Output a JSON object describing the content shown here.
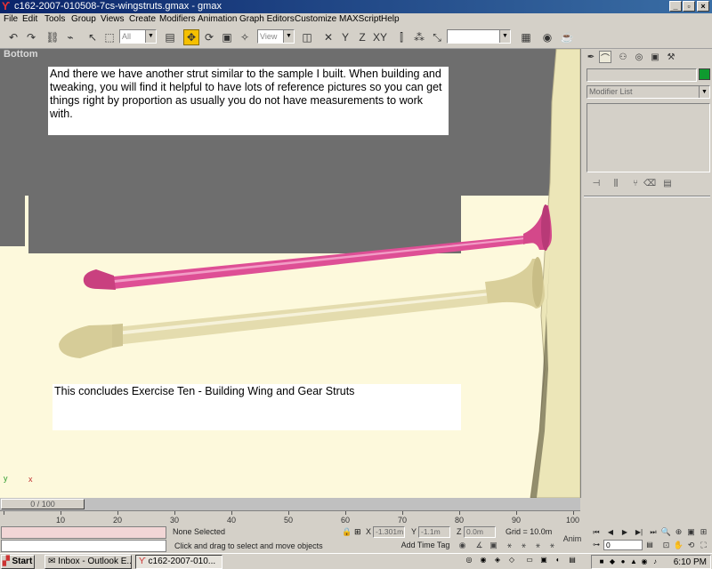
{
  "window": {
    "title": "c162-2007-010508-7cs-wingstruts.gmax - gmax",
    "app_icon": "gmax-icon",
    "controls": [
      "minimize",
      "maximize",
      "close"
    ]
  },
  "menu": [
    "File",
    "Edit",
    "Tools",
    "Group",
    "Views",
    "Create",
    "Modifiers",
    "Animation",
    "Graph Editors",
    "Customize",
    "MAXScript",
    "Help"
  ],
  "toolbar": {
    "selection_filter": "All",
    "reference_coord": "View"
  },
  "viewport": {
    "label": "Bottom",
    "note_top": "And there we have another strut similar to the sample I built. When building and tweaking, you will find it helpful to have lots of reference pictures so you can get things right by proportion as usually you do not have measurements to work with.",
    "note_bottom": "This concludes Exercise Ten - Building Wing and Gear Struts",
    "axis_y": "y",
    "axis_x": "x",
    "colors": {
      "pink_strut": "#e0559a",
      "tan_strut": "#e4dcae",
      "background": "#fdf9dc",
      "gray": "#6e6e6e"
    }
  },
  "command_panel": {
    "modifier_list": "Modifier List",
    "object_color": "#0f9a2f"
  },
  "time_slider": {
    "label": "0 / 100",
    "ticks": [
      "10",
      "20",
      "30",
      "40",
      "50",
      "60",
      "70",
      "80",
      "90",
      "100"
    ]
  },
  "status": {
    "selection": "None Selected",
    "prompt": "Click and drag to select and move objects",
    "x_label": "X",
    "x_value": "-1.301m",
    "y_label": "Y",
    "y_value": "-1.1m",
    "z_label": "Z",
    "z_value": "0.0m",
    "grid": "Grid = 10.0m",
    "add_time_tag": "Add Time Tag",
    "anim": "Anim",
    "frame": "0"
  },
  "taskbar": {
    "start": "Start",
    "tasks": [
      "Inbox - Outlook E...",
      "c162-2007-010..."
    ],
    "clock": "6:10 PM"
  }
}
